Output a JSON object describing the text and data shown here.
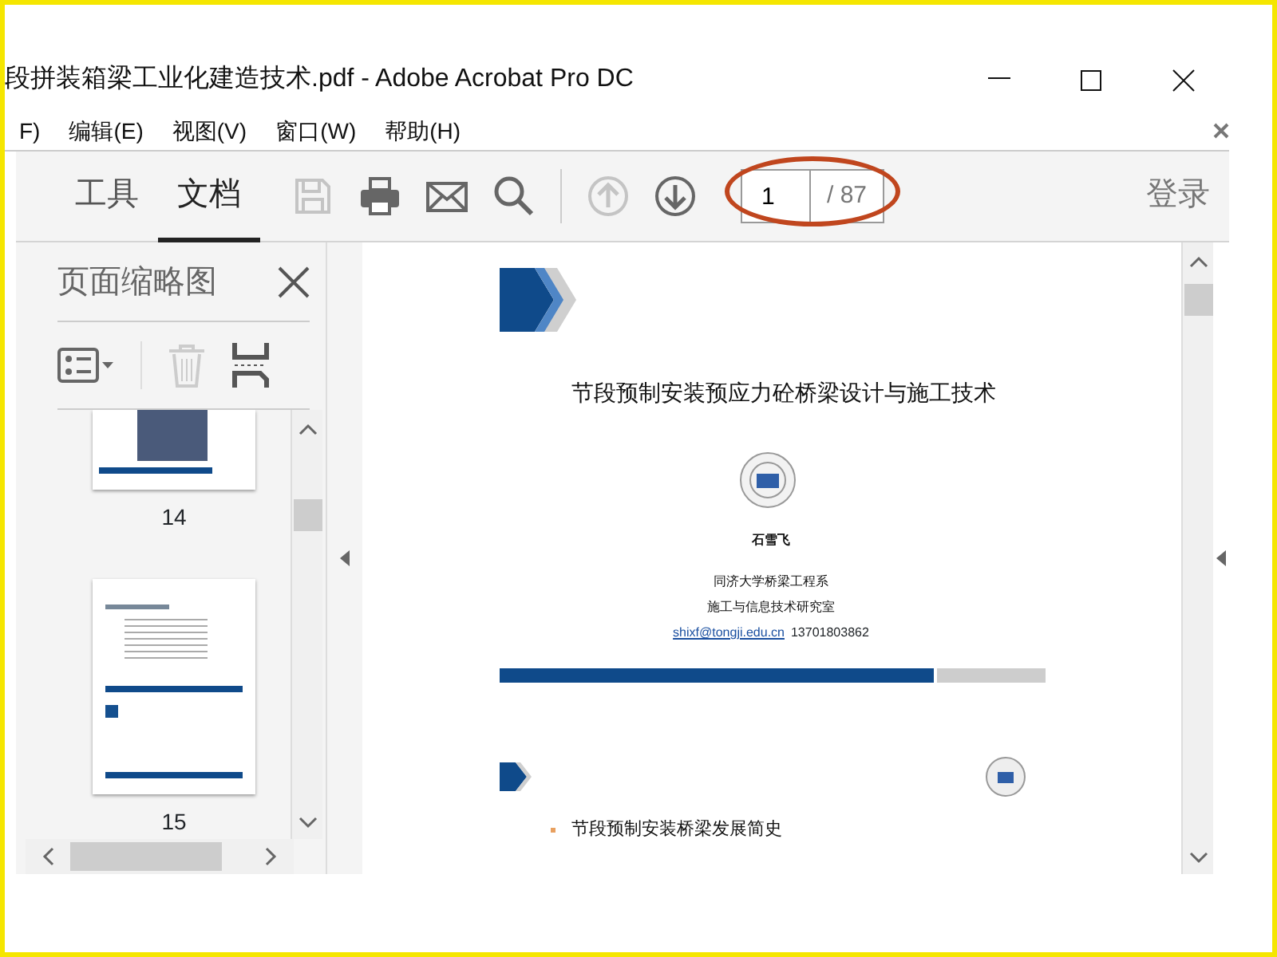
{
  "window": {
    "title": "段拼装箱梁工业化建造技术.pdf - Adobe Acrobat Pro DC"
  },
  "menu": [
    {
      "label": "F)"
    },
    {
      "label": "编辑(E)"
    },
    {
      "label": "视图(V)"
    },
    {
      "label": "窗口(W)"
    },
    {
      "label": "帮助(H)"
    }
  ],
  "tabs": [
    {
      "label": "工具",
      "selected": false
    },
    {
      "label": "文档",
      "selected": true
    }
  ],
  "toolbar": [
    {
      "kind": "save",
      "disabled": true
    },
    {
      "kind": "print",
      "disabled": false
    },
    {
      "kind": "mail",
      "disabled": false
    },
    {
      "kind": "search",
      "disabled": false
    },
    {
      "kind": "sep"
    },
    {
      "kind": "up",
      "disabled": true
    },
    {
      "kind": "down",
      "disabled": false
    }
  ],
  "page_field": {
    "value": "1",
    "total": "/ 87"
  },
  "sign_in": "登录",
  "thumbnails_panel": {
    "title": "页面缩略图",
    "thumbnails": [
      {
        "label": "14",
        "kind": "photo"
      },
      {
        "label": "15",
        "kind": "text"
      }
    ]
  },
  "document": {
    "title": "节段预制安装预应力砼桥梁设计与施工技术",
    "author": "石雪飞",
    "affiliation": [
      "同济大学桥梁工程系",
      "施工与信息技术研究室"
    ],
    "email": "shixf@tongji.edu.cn",
    "phone": "13701803862",
    "bullets": [
      "节段预制安装桥梁发展简史"
    ]
  }
}
